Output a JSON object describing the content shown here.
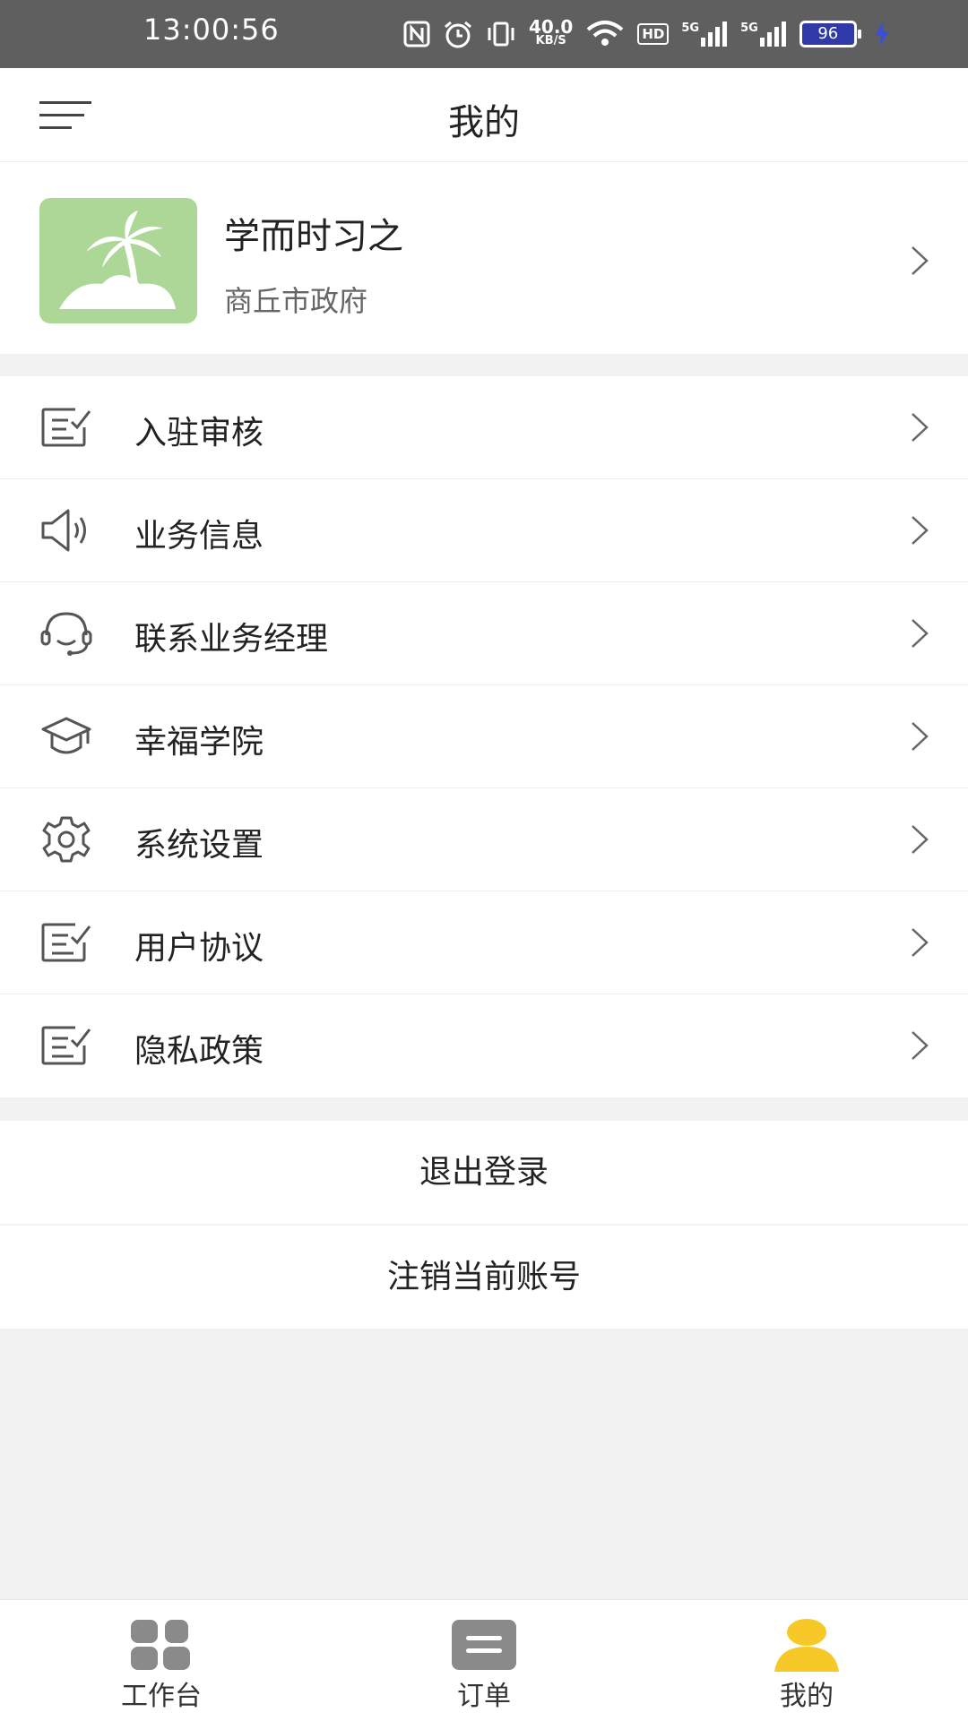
{
  "status_bar": {
    "time": "13:00:56",
    "net_speed_value": "40.0",
    "net_speed_unit": "KB/S",
    "hd_label": "HD",
    "signal_label_1": "5G",
    "signal_label_2": "5G",
    "battery_level": "96",
    "icons": [
      "nfc-icon",
      "alarm-icon",
      "vibrate-icon",
      "wifi-icon",
      "hd-icon",
      "signal-icon",
      "battery-icon",
      "charging-icon"
    ]
  },
  "header": {
    "title": "我的",
    "menu_icon": "menu-icon"
  },
  "profile": {
    "name": "学而时习之",
    "organization": "商丘市政府",
    "avatar_icon": "palm-tree-image",
    "avatar_color": "#acd797"
  },
  "menu": {
    "items": [
      {
        "label": "入驻审核",
        "icon": "checklist-icon"
      },
      {
        "label": "业务信息",
        "icon": "megaphone-icon"
      },
      {
        "label": "联系业务经理",
        "icon": "headset-icon"
      },
      {
        "label": "幸福学院",
        "icon": "graduation-cap-icon"
      },
      {
        "label": "系统设置",
        "icon": "gear-icon"
      },
      {
        "label": "用户协议",
        "icon": "checklist-icon"
      },
      {
        "label": "隐私政策",
        "icon": "checklist-icon"
      }
    ]
  },
  "actions": {
    "logout": "退出登录",
    "deregister": "注销当前账号"
  },
  "bottom_nav": {
    "tabs": [
      {
        "label": "工作台",
        "icon": "grid-icon",
        "active": false
      },
      {
        "label": "订单",
        "icon": "order-icon",
        "active": false
      },
      {
        "label": "我的",
        "icon": "user-icon",
        "active": true
      }
    ],
    "active_color": "#f7c928",
    "inactive_color": "#8a8a8a"
  }
}
